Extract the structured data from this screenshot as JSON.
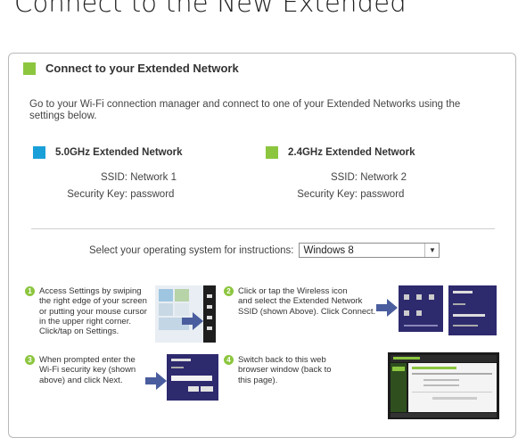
{
  "page": {
    "heading": "Connect to the New Extended"
  },
  "panel": {
    "title": "Connect to your Extended Network",
    "intro": "Go to your Wi-Fi connection manager and connect to one of your Extended Networks using the settings below."
  },
  "networks": [
    {
      "title": "5.0GHz Extended Network",
      "ssid_label": "SSID:",
      "ssid": "Network 1",
      "key_label": "Security Key:",
      "key": "password",
      "color": "#1aa0d8"
    },
    {
      "title": "2.4GHz Extended Network",
      "ssid_label": "SSID:",
      "ssid": "Network 2",
      "key_label": "Security Key:",
      "key": "password",
      "color": "#8cc63f"
    }
  ],
  "os_select": {
    "label": "Select your operating system for instructions:",
    "value": "Windows 8"
  },
  "steps": [
    {
      "num": "1",
      "lines": [
        "Access Settings by swiping",
        "the right edge of your screen",
        "or putting your mouse cursor",
        "in the upper right corner.",
        "Click/tap on Settings."
      ]
    },
    {
      "num": "2",
      "lines": [
        "Click or tap the Wireless icon",
        "and select the Extended Network",
        "SSID (shown Above). Click Connect."
      ]
    },
    {
      "num": "3",
      "lines": [
        "When prompted enter the",
        "Wi-Fi security key (shown",
        "above) and click Next."
      ]
    },
    {
      "num": "4",
      "lines": [
        "Switch back to this web",
        "browser window (back to",
        "this page)."
      ]
    }
  ],
  "colors": {
    "accent_green": "#8cc63f",
    "accent_blue": "#1aa0d8",
    "win8_purple": "#2e2a6e",
    "arrow_blue": "#4a5d9e"
  },
  "icons": [
    "windows-start-tiles-thumbnail",
    "settings-charm-thumbnail",
    "wireless-networks-thumbnail",
    "security-key-dialog-thumbnail",
    "browser-window-thumbnail",
    "arrow-right-icon"
  ]
}
